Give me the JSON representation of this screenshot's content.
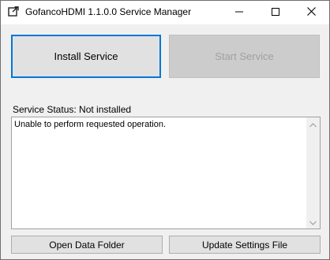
{
  "window": {
    "title": "GofancoHDMI 1.1.0.0 Service Manager",
    "icon": "external-link-icon"
  },
  "titlebar_controls": {
    "minimize_icon": "minimize-icon",
    "maximize_icon": "maximize-icon",
    "close_icon": "close-icon"
  },
  "actions": {
    "install_label": "Install Service",
    "start_label": "Start Service",
    "start_enabled": false
  },
  "status": {
    "label": "Service Status: Not installed"
  },
  "output": {
    "text": "Unable to perform requested operation."
  },
  "footer": {
    "open_folder_label": "Open Data Folder",
    "update_settings_label": "Update Settings File"
  },
  "colors": {
    "focus_border": "#0078d7",
    "button_face": "#e1e1e1",
    "disabled_face": "#cccccc",
    "disabled_text": "#a0a0a0",
    "window_bg": "#f0f0f0"
  }
}
